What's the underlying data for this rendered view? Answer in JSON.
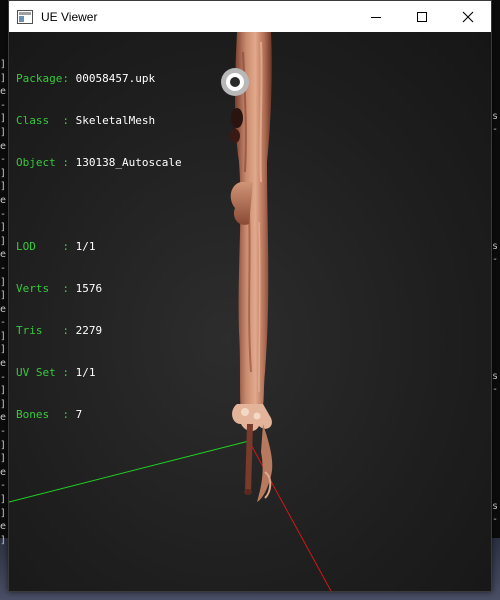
{
  "window": {
    "title": "UE Viewer"
  },
  "info": {
    "package_label": "Package:",
    "package_value": "00058457.upk",
    "class_label": "Class  :",
    "class_value": "SkeletalMesh",
    "object_label": "Object :",
    "object_value": "130138_Autoscale",
    "lod_label": "LOD    :",
    "lod_value": "1/1",
    "verts_label": "Verts  :",
    "verts_value": "1576",
    "tris_label": "Tris   :",
    "tris_value": "2279",
    "uvset_label": "UV Set :",
    "uvset_value": "1/1",
    "bones_label": "Bones  :",
    "bones_value": "7"
  },
  "colors": {
    "label_green": "#37c93e",
    "value_white": "#ffffff",
    "axis_green": "#22d022",
    "axis_red": "#d01818",
    "mesh_flesh": "#c98a6e"
  },
  "icons": {
    "app": "window-icon",
    "minimize": "minimize-icon",
    "maximize": "maximize-icon",
    "close": "close-icon"
  }
}
